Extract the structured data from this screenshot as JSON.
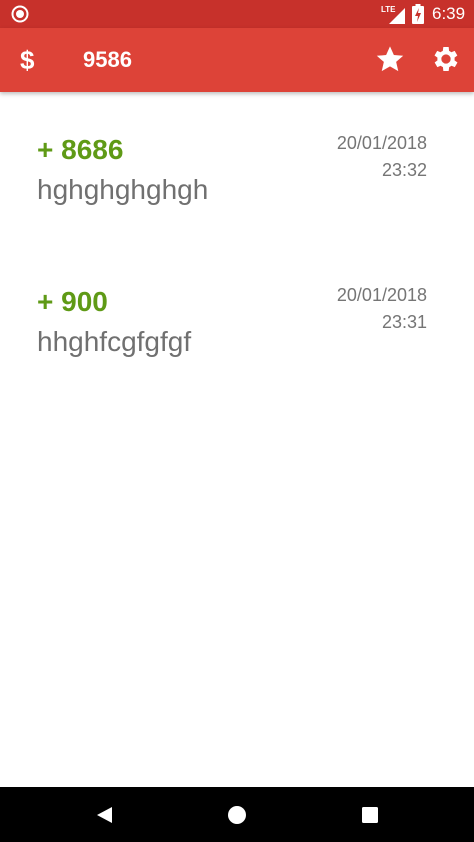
{
  "status_bar": {
    "time": "6:39",
    "network": "LTE",
    "icons": [
      "screen-record-icon",
      "lte-signal-icon",
      "battery-charging-icon"
    ]
  },
  "app_bar": {
    "currency_symbol": "$",
    "balance": "9586",
    "icons": [
      "dollar-icon",
      "star-icon",
      "gear-icon"
    ],
    "color": "#dd4338"
  },
  "transactions": [
    {
      "amount": "+ 8686",
      "note": "hghghghghgh",
      "date": "20/01/2018",
      "time": "23:32"
    },
    {
      "amount": "+ 900",
      "note": "hhghfcgfgfgf",
      "date": "20/01/2018",
      "time": "23:31"
    }
  ],
  "colors": {
    "status_bar": "#c7312b",
    "income_amount": "#5f9a16",
    "secondary_text": "#757575"
  },
  "nav_bar": {
    "icons": [
      "back-icon",
      "home-icon",
      "recents-icon"
    ]
  }
}
